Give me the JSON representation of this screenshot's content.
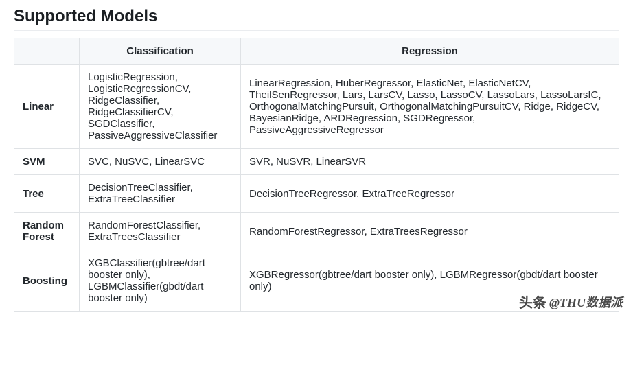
{
  "title": "Supported Models",
  "headers": {
    "empty": "",
    "classification": "Classification",
    "regression": "Regression"
  },
  "rows": [
    {
      "category": "Linear",
      "classification": "LogisticRegression, LogisticRegressionCV, RidgeClassifier, RidgeClassifierCV, SGDClassifier, PassiveAggressiveClassifier",
      "regression": "LinearRegression, HuberRegressor, ElasticNet, ElasticNetCV, TheilSenRegressor, Lars, LarsCV, Lasso, LassoCV, LassoLars, LassoLarsIC, OrthogonalMatchingPursuit, OrthogonalMatchingPursuitCV, Ridge, RidgeCV, BayesianRidge, ARDRegression, SGDRegressor, PassiveAggressiveRegressor"
    },
    {
      "category": "SVM",
      "classification": "SVC, NuSVC, LinearSVC",
      "regression": "SVR, NuSVR, LinearSVR"
    },
    {
      "category": "Tree",
      "classification": "DecisionTreeClassifier, ExtraTreeClassifier",
      "regression": "DecisionTreeRegressor, ExtraTreeRegressor"
    },
    {
      "category": "Random Forest",
      "classification": "RandomForestClassifier, ExtraTreesClassifier",
      "regression": "RandomForestRegressor, ExtraTreesRegressor"
    },
    {
      "category": "Boosting",
      "classification": "XGBClassifier(gbtree/dart booster only), LGBMClassifier(gbdt/dart booster only)",
      "regression": "XGBRegressor(gbtree/dart booster only), LGBMRegressor(gbdt/dart booster only)"
    }
  ],
  "watermark": {
    "icon": "头条",
    "text": "@THU数据派"
  }
}
